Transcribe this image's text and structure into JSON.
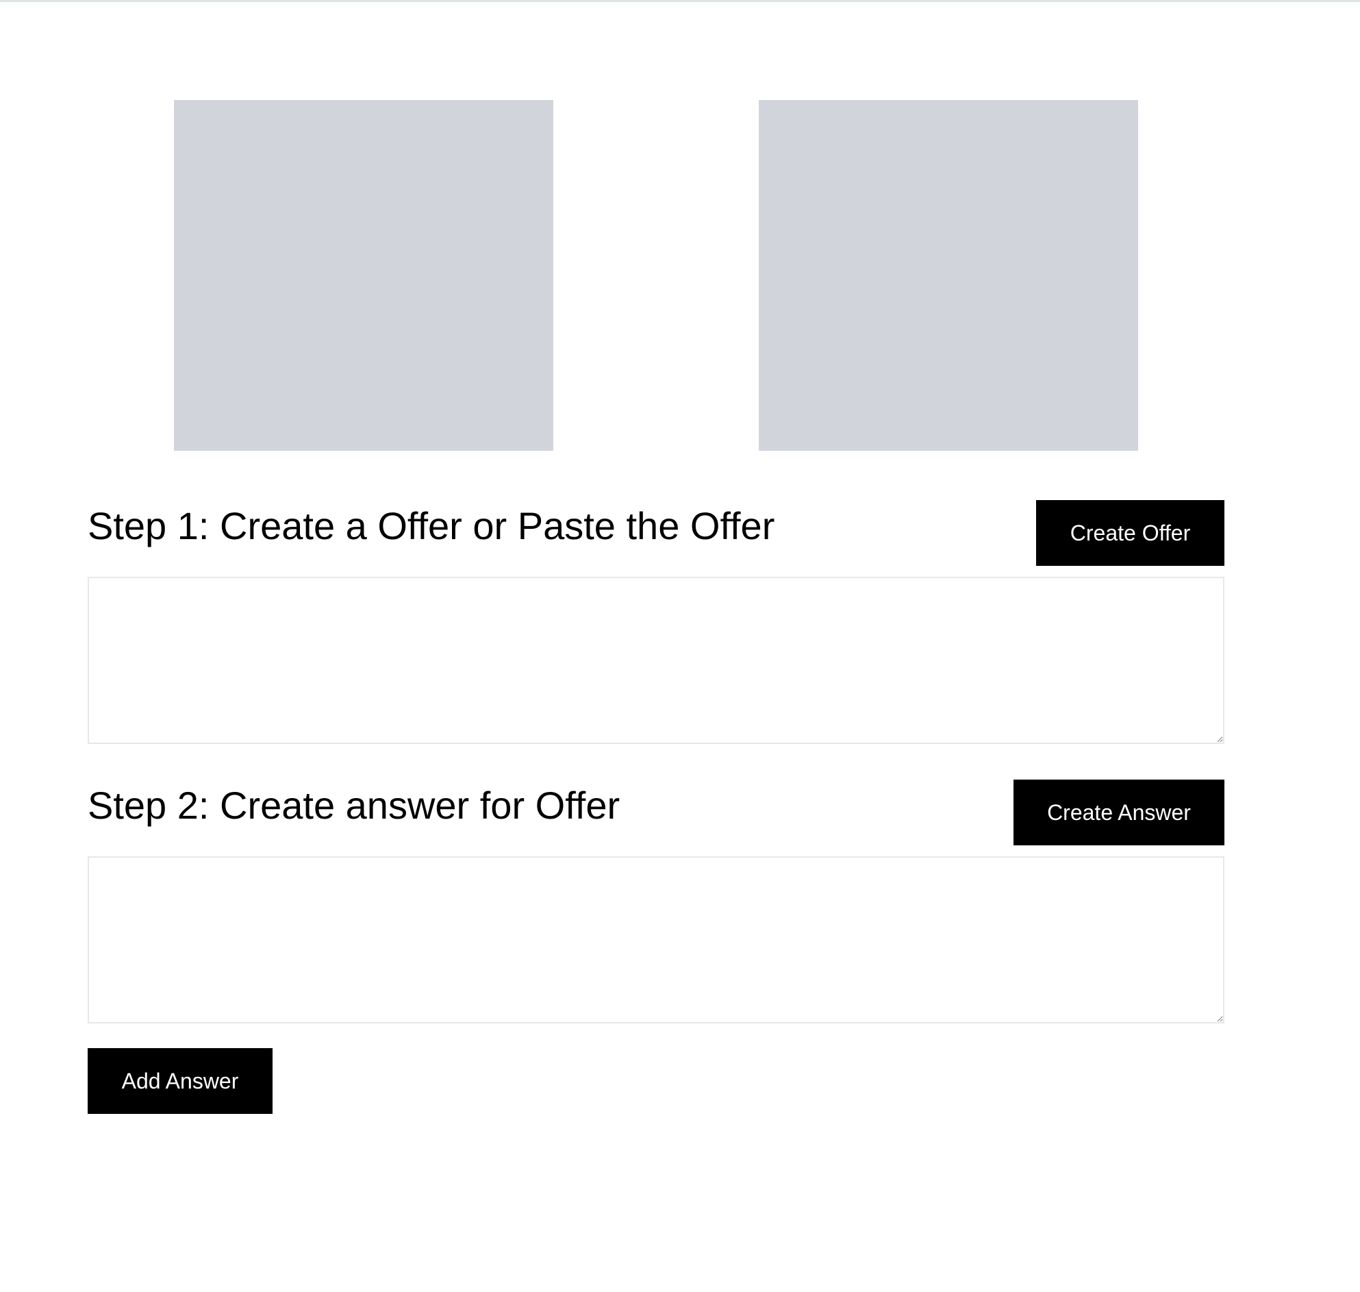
{
  "videos": {
    "local_label": "",
    "remote_label": ""
  },
  "step1": {
    "title": "Step 1: Create a Offer or Paste the Offer",
    "button_label": "Create Offer",
    "textarea_value": ""
  },
  "step2": {
    "title": "Step 2: Create answer for Offer",
    "button_label": "Create Answer",
    "textarea_value": ""
  },
  "actions": {
    "add_answer_label": "Add Answer"
  },
  "colors": {
    "video_placeholder": "#d1d5db",
    "button_bg": "#000000",
    "button_text": "#ffffff",
    "textarea_border": "#e5e7eb",
    "top_rule": "#dde4e2"
  }
}
